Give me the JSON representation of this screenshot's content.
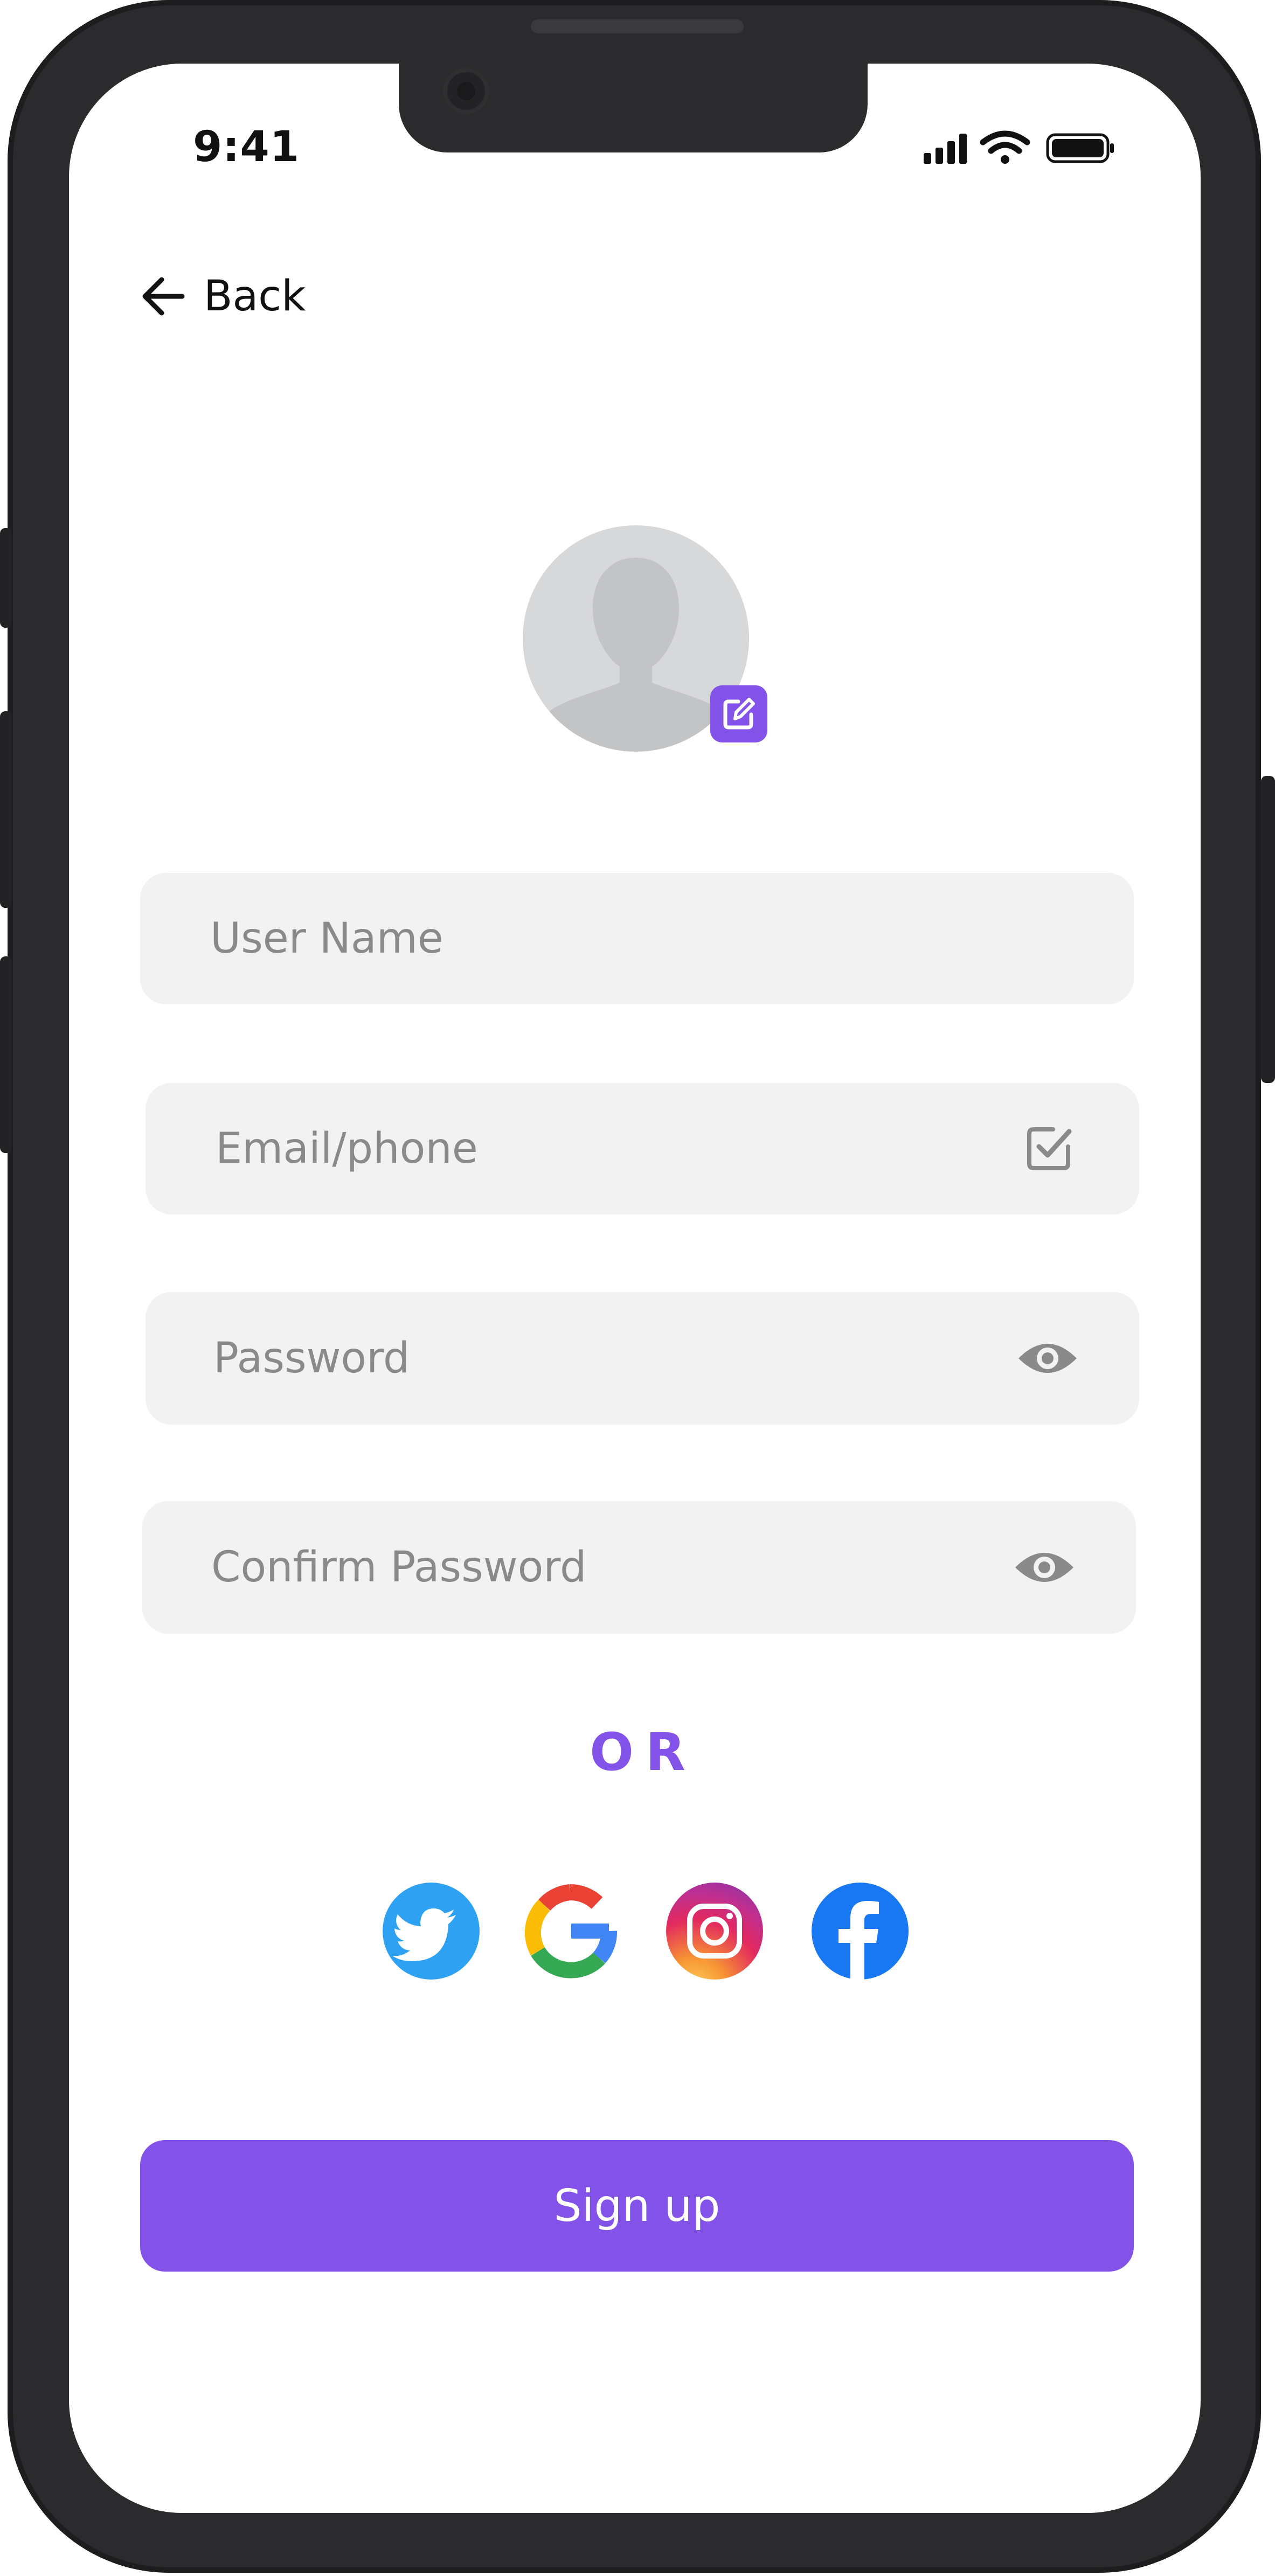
{
  "status_bar": {
    "time": "9:41"
  },
  "nav": {
    "back_label": "Back"
  },
  "form": {
    "username_placeholder": "User Name",
    "email_placeholder": "Email/phone",
    "password_placeholder": "Password",
    "confirm_password_placeholder": "Confirm Password"
  },
  "divider_text": "OR",
  "social_icons": [
    "twitter-icon",
    "google-icon",
    "instagram-icon",
    "facebook-icon"
  ],
  "signup": {
    "label": "Sign up"
  },
  "colors": {
    "accent": "#8352e8",
    "field_bg": "#f2f2f2",
    "placeholder": "#8a8a8a"
  }
}
